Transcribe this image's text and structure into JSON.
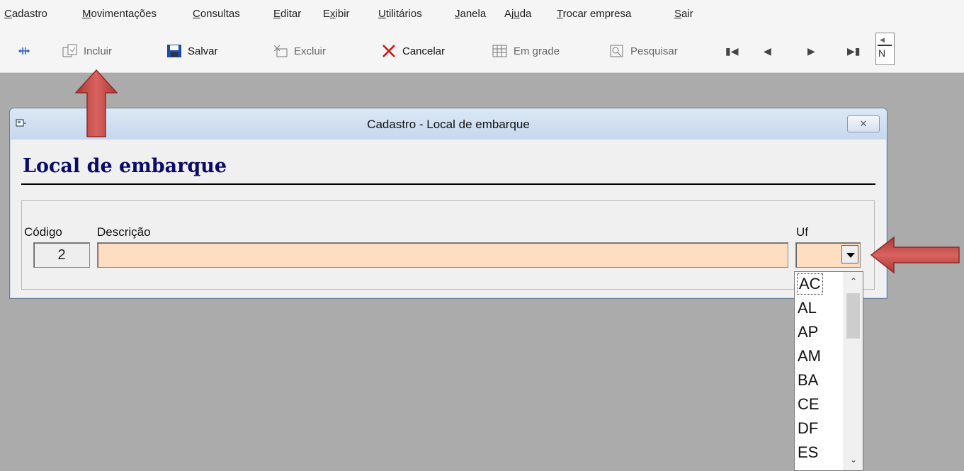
{
  "menubar": {
    "items": [
      {
        "pre": "",
        "u": "C",
        "post": "adastro"
      },
      {
        "pre": "",
        "u": "M",
        "post": "ovimentações"
      },
      {
        "pre": "",
        "u": "C",
        "post": "onsultas"
      },
      {
        "pre": "",
        "u": "E",
        "post": "ditar"
      },
      {
        "pre": "E",
        "u": "x",
        "post": "ibir"
      },
      {
        "pre": "",
        "u": "U",
        "post": "tilitários"
      },
      {
        "pre": "",
        "u": "J",
        "post": "anela"
      },
      {
        "pre": "Aj",
        "u": "u",
        "post": "da"
      },
      {
        "pre": "",
        "u": "T",
        "post": "rocar empresa"
      },
      {
        "pre": "",
        "u": "S",
        "post": "air"
      }
    ]
  },
  "toolbar": {
    "incluir": "Incluir",
    "salvar": "Salvar",
    "excluir": "Excluir",
    "cancelar": "Cancelar",
    "em_grade": "Em grade",
    "pesquisar": "Pesquisar",
    "nav_partial": "N"
  },
  "window": {
    "title": "Cadastro - Local de embarque",
    "heading": "Local de embarque",
    "close_glyph": "✕"
  },
  "form": {
    "codigo_label": "Código",
    "descricao_label": "Descrição",
    "uf_label": "Uf",
    "codigo_value": "2",
    "descricao_value": "",
    "uf_value": ""
  },
  "uf_options": [
    "AC",
    "AL",
    "AP",
    "AM",
    "BA",
    "CE",
    "DF",
    "ES"
  ],
  "colors": {
    "input_highlight": "#ffddc0",
    "heading": "#0a0a6b",
    "arrow": "#c0504d"
  }
}
